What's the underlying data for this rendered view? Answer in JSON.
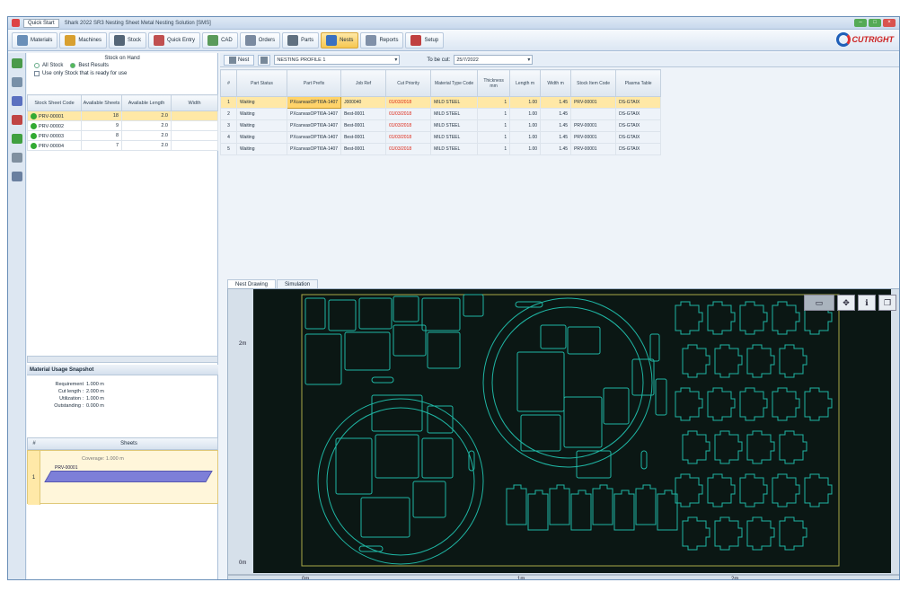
{
  "titlebar": {
    "quick_tab": "Quick Start",
    "title": "Shark 2022 SR3 Nesting Sheet Metal Nesting Solution [SMS]"
  },
  "ribbon": {
    "buttons": [
      {
        "label": "Materials",
        "icon": "materials-icon",
        "color": "#6a8fb8"
      },
      {
        "label": "Machines",
        "icon": "machines-icon",
        "color": "#d8a030"
      },
      {
        "label": "Stock",
        "icon": "stock-icon",
        "color": "#556677"
      },
      {
        "label": "Quick Entry",
        "icon": "quick-entry-icon",
        "color": "#c05050"
      },
      {
        "label": "CAD",
        "icon": "cad-icon",
        "color": "#5a9a5a"
      },
      {
        "label": "Orders",
        "icon": "orders-icon",
        "color": "#7a8aa0"
      },
      {
        "label": "Parts",
        "icon": "parts-icon",
        "color": "#607080"
      },
      {
        "label": "Nests",
        "icon": "nests-icon",
        "color": "#3a70c0"
      },
      {
        "label": "Reports",
        "icon": "reports-icon",
        "color": "#8090a8"
      },
      {
        "label": "Setup",
        "icon": "setup-icon",
        "color": "#c04040"
      }
    ],
    "active_index": 7,
    "brand": "CUTRIGHT"
  },
  "leftpanel": {
    "header": "Stock on Hand",
    "options": [
      {
        "label": "All Stock",
        "selected": false
      },
      {
        "label": "Best Results",
        "selected": true
      }
    ],
    "checkbox_label": "Use only Stock that is ready for use",
    "columns": [
      "Stock Sheet Code",
      "Available Sheets",
      "Available Length",
      "Width"
    ],
    "rows": [
      {
        "code": "PRV-00001",
        "sheets": "18",
        "length": "2.0",
        "width": "",
        "selected": true
      },
      {
        "code": "PRV-00002",
        "sheets": "9",
        "length": "2.0",
        "width": "",
        "selected": false
      },
      {
        "code": "PRV-00003",
        "sheets": "8",
        "length": "2.0",
        "width": "",
        "selected": false
      },
      {
        "code": "PRV-00004",
        "sheets": "7",
        "length": "2.0",
        "width": "",
        "selected": false
      }
    ]
  },
  "material_info": {
    "title": "Material Usage Snapshot",
    "items": [
      {
        "label": "Requirement :",
        "value": "1.000 m"
      },
      {
        "label": "Cut length :",
        "value": "2.000 m"
      },
      {
        "label": "Utilization :",
        "value": "1.000 m"
      },
      {
        "label": "Outstanding :",
        "value": "0.000 m"
      }
    ]
  },
  "sheets": {
    "col1": "#",
    "col2": "Sheets",
    "row_no": "1",
    "usage_text": "Coverage: 1.000 m",
    "bar_label": "PRV-00001",
    "usage_fraction": 0.9
  },
  "toolbar": {
    "nest_button": "Nest",
    "profile_combo": "NESTING PROFILE 1",
    "due_label": "To be cut:",
    "due_value": "25/7/2022"
  },
  "parts_table": {
    "columns": [
      "#",
      "Part Status",
      "Part Prefix",
      "Job Ref",
      "Cut Priority",
      "Material Type Code",
      "Thickness mm",
      "Length m",
      "Width m",
      "Stock Item Code",
      "Plasma Table"
    ],
    "rows": [
      {
        "n": "1",
        "status": "Waiting",
        "prefix": "PXcanvasOPTI0A-1407",
        "job": "J000040",
        "prio": "01/03/2018",
        "mat": "MILD STEEL",
        "thk": "1",
        "len": "1.00",
        "wid": "1.45",
        "stock": "PRV-00001",
        "table": "DS-GTAIX",
        "selected": true
      },
      {
        "n": "2",
        "status": "Waiting",
        "prefix": "PXcanvasOPTI0A-1407",
        "job": "Best-0001",
        "prio": "01/03/2018",
        "mat": "MILD STEEL",
        "thk": "1",
        "len": "1.00",
        "wid": "1.45",
        "stock": "",
        "table": "DS-GTAIX",
        "selected": false
      },
      {
        "n": "3",
        "status": "Waiting",
        "prefix": "PXcanvasOPTI0A-1407",
        "job": "Best-0001",
        "prio": "01/03/2018",
        "mat": "MILD STEEL",
        "thk": "1",
        "len": "1.00",
        "wid": "1.45",
        "stock": "PRV-00001",
        "table": "DS-GTAIX",
        "selected": false
      },
      {
        "n": "4",
        "status": "Waiting",
        "prefix": "PXcanvasOPTI0A-1407",
        "job": "Best-0001",
        "prio": "01/03/2018",
        "mat": "MILD STEEL",
        "thk": "1",
        "len": "1.00",
        "wid": "1.45",
        "stock": "PRV-00001",
        "table": "DS-GTAIX",
        "selected": false
      },
      {
        "n": "5",
        "status": "Waiting",
        "prefix": "PXcanvasOPTI0A-1407",
        "job": "Best-0001",
        "prio": "01/03/2018",
        "mat": "MILD STEEL",
        "thk": "1",
        "len": "1.00",
        "wid": "1.45",
        "stock": "PRV-00001",
        "table": "DS-GTAIX",
        "selected": false
      }
    ]
  },
  "drawing_tabs": [
    "Nest Drawing",
    "Simulation"
  ],
  "drawing": {
    "y_labels": [
      "2m",
      "0m"
    ],
    "x_labels": [
      "0m",
      "1m",
      "2m"
    ],
    "colors": {
      "background": "#0b1714",
      "outline": "#1fb5a3",
      "frame": "#a8a848"
    }
  }
}
